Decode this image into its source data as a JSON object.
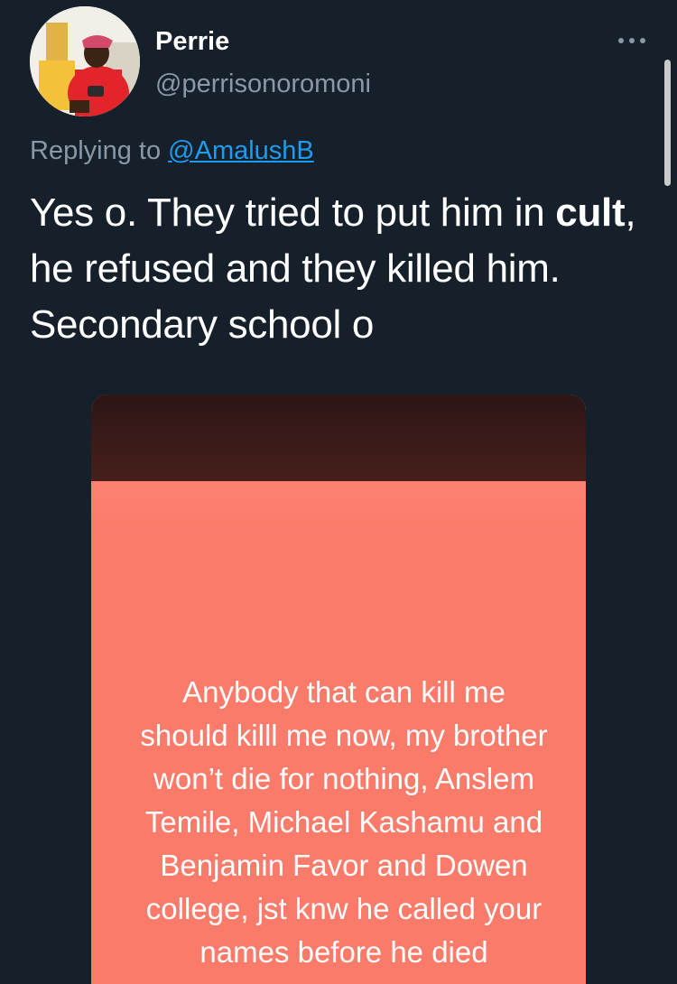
{
  "author": {
    "display_name": "Perrie",
    "handle": "@perrisonoromoni",
    "avatar_icon": "profile-photo"
  },
  "more_icon": "more-options-icon",
  "reply": {
    "prefix": "Replying to",
    "mention": "@AmalushB"
  },
  "tweet": {
    "text_part1": "Yes o. They tried to put him in ",
    "text_bold": "cult",
    "text_part2": ", he refused and they killed him. Secondary school o"
  },
  "media": {
    "caption": "Anybody that can kill me\nshould killl me now, my brother\nwon’t die for nothing, Anslem\nTemile, Michael Kashamu and\nBenjamin Favor and Dowen\ncollege, jst knw he called your\nnames before he died"
  },
  "colors": {
    "background": "#15202b",
    "link": "#1d9bf0",
    "secondary_text": "#8b98a5",
    "media_background": "#fb7b6b"
  }
}
